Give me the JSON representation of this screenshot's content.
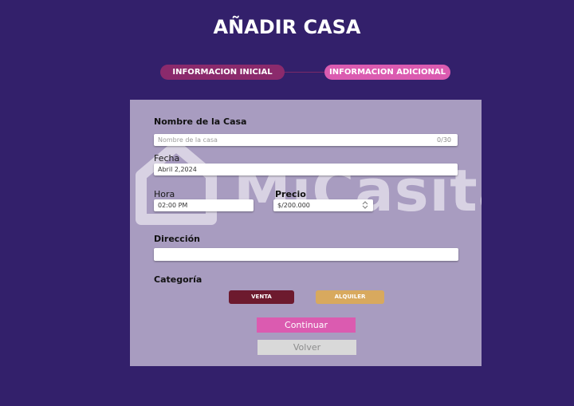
{
  "page": {
    "title": "AÑADIR CASA"
  },
  "steps": [
    {
      "label": "INFORMACION INICIAL"
    },
    {
      "label": "INFORMACION ADICIONAL"
    }
  ],
  "watermark": {
    "text": "MiCasita"
  },
  "form": {
    "nombre": {
      "label": "Nombre de la Casa",
      "placeholder": "Nombre de la casa",
      "counter": "0/30"
    },
    "fecha": {
      "label": "Fecha",
      "value": "Abril 2,2024"
    },
    "hora": {
      "label": "Hora",
      "value": "02:00 PM"
    },
    "precio": {
      "label": "Precio",
      "value": "$/200.000"
    },
    "direccion": {
      "label": "Dirección",
      "value": ""
    },
    "categoria": {
      "label": "Categoría",
      "options": [
        "VENTA",
        "ALQUILER"
      ]
    }
  },
  "actions": {
    "continuar": "Continuar",
    "volver": "Volver"
  },
  "colors": {
    "background": "#33206b",
    "card": "#a89cc0",
    "accent_pink": "#db5bb0",
    "step_inactive": "#8b2a6c",
    "venta": "#6d1a2e",
    "alquiler": "#d8a95e"
  }
}
